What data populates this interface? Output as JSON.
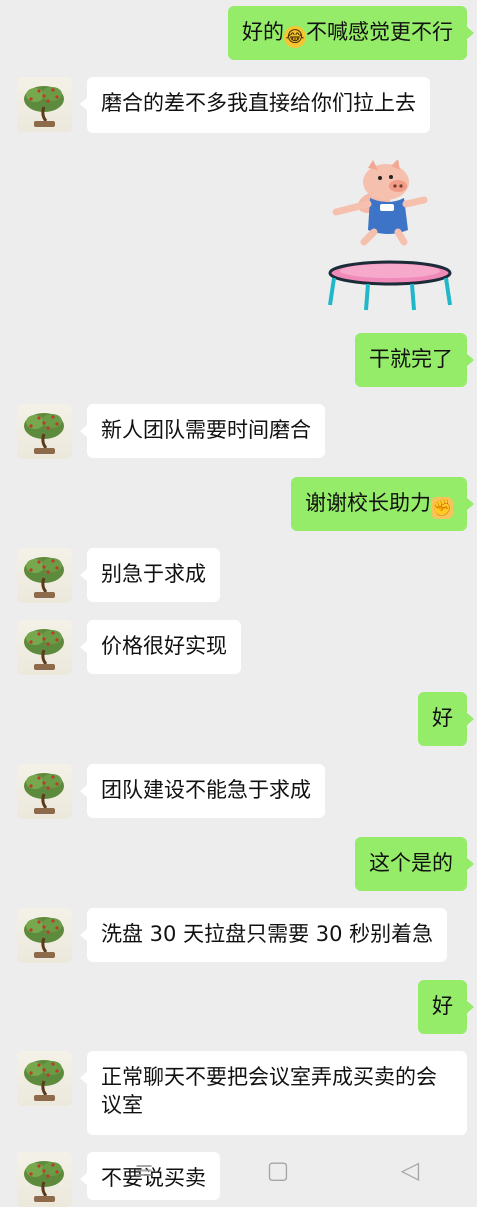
{
  "messages": [
    {
      "side": "right",
      "text": "好的",
      "emoji": "😂",
      "text2": "不喊感觉更不行"
    },
    {
      "side": "left",
      "text": "磨合的差不多我直接给你们拉上去"
    },
    {
      "side": "right",
      "text": "干就完了"
    },
    {
      "side": "left",
      "text": "新人团队需要时间磨合"
    },
    {
      "side": "right",
      "text": "谢谢校长助力",
      "emoji": "✊"
    },
    {
      "side": "left",
      "text": "别急于求成"
    },
    {
      "side": "left",
      "text": "价格很好实现"
    },
    {
      "side": "right",
      "text": "好"
    },
    {
      "side": "left",
      "text": "团队建设不能急于求成"
    },
    {
      "side": "right",
      "text": "这个是的"
    },
    {
      "side": "left",
      "text": "洗盘 30 天拉盘只需要 30 秒别着急"
    },
    {
      "side": "right",
      "text": "好"
    },
    {
      "side": "left",
      "text": "正常聊天不要把会议室弄成买卖的会议室"
    },
    {
      "side": "left",
      "text": "不要说买卖"
    }
  ],
  "sticker": {
    "name": "pig-trampoline-sticker"
  },
  "navbar": {
    "menu_icon": "≡",
    "home_icon": "▢",
    "back_icon": "◁"
  },
  "colors": {
    "background": "#ededed",
    "self_bubble": "#95ec69",
    "other_bubble": "#ffffff",
    "text": "#111111"
  }
}
